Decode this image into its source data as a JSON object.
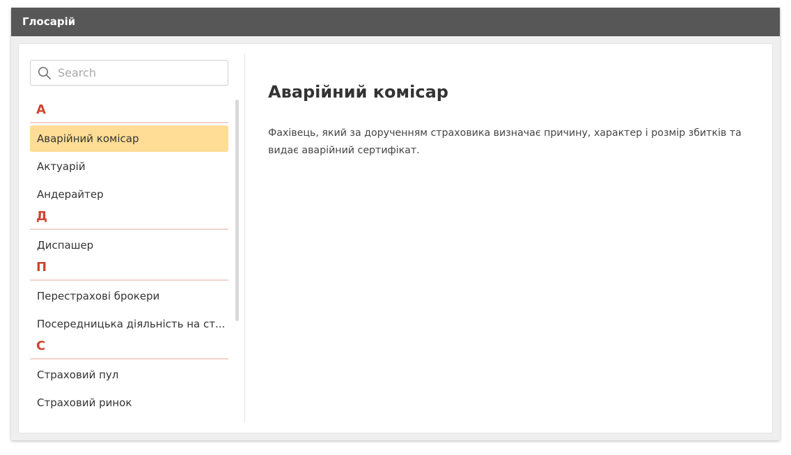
{
  "window": {
    "title": "Глосарій"
  },
  "search": {
    "placeholder": "Search",
    "value": ""
  },
  "glossary": {
    "sections": [
      {
        "letter": "А",
        "items": [
          "Аварійний комісар",
          "Актуарій",
          "Андерайтер"
        ]
      },
      {
        "letter": "Д",
        "items": [
          "Диспашер"
        ]
      },
      {
        "letter": "П",
        "items": [
          "Перестрахові брокери",
          "Посередницька діяльність на ст..."
        ]
      },
      {
        "letter": "С",
        "items": [
          "Страховий пул",
          "Страховий ринок"
        ]
      }
    ],
    "selected": "Аварійний комісар"
  },
  "detail": {
    "title": "Аварійний комісар",
    "text": "Фахівець, який за дорученням страховика визначає причину, характер і розмір збитків та видає аварійний сертифікат."
  },
  "colors": {
    "titlebar": "#575757",
    "letter": "#d0452f",
    "letter_underline": "#f3d3ca",
    "selected": "#ffdd96"
  },
  "icons": {
    "search": "search-icon"
  }
}
